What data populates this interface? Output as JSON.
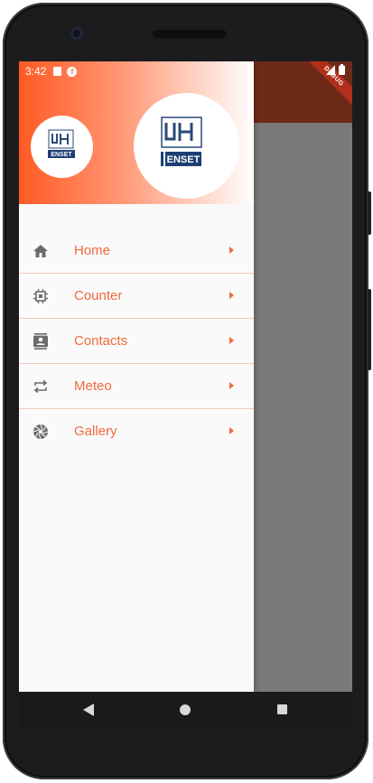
{
  "status_bar": {
    "time": "3:42"
  },
  "debug_banner": "DEBUG",
  "drawer": {
    "header": {
      "logo_small_text": "ENSET",
      "logo_big_text": "ENSET"
    },
    "items": [
      {
        "label": "Home",
        "icon": "home-icon"
      },
      {
        "label": "Counter",
        "icon": "chip-icon"
      },
      {
        "label": "Contacts",
        "icon": "contacts-icon"
      },
      {
        "label": "Meteo",
        "icon": "repeat-icon"
      },
      {
        "label": "Gallery",
        "icon": "camera-shutter-icon"
      }
    ]
  },
  "colors": {
    "accent": "#f26a3b",
    "header_gradient_start": "#ff5a23",
    "divider": "#f4c9bc",
    "icon_gray": "#6b6b6b"
  }
}
